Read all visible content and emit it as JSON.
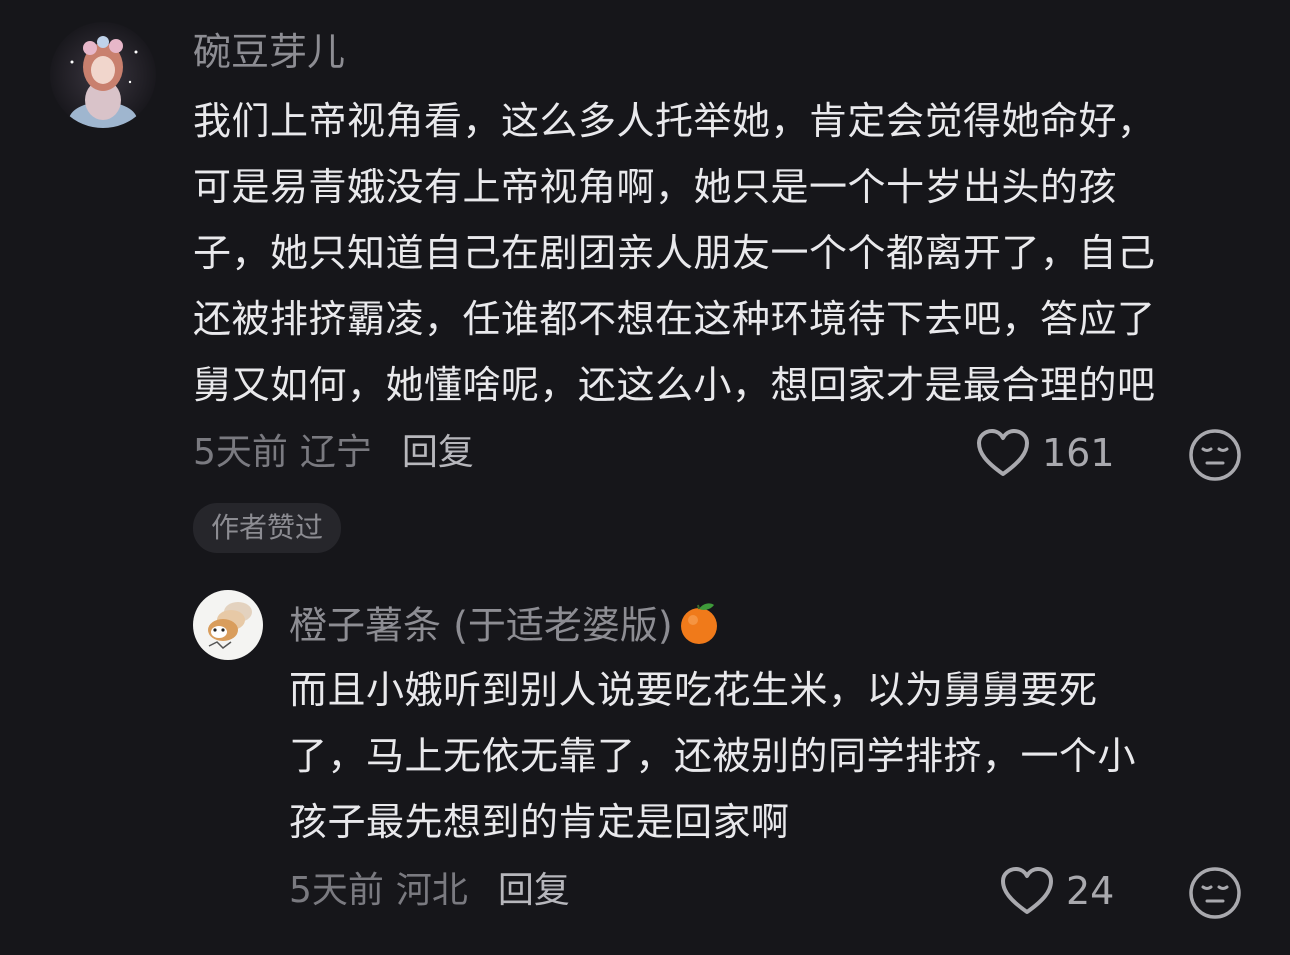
{
  "comments": [
    {
      "username": "碗豆芽儿",
      "lines": [
        "我们上帝视角看，这么多人托举她，肯定会觉得她命好，",
        "可是易青娥没有上帝视角啊，她只是一个十岁出头的孩",
        "子，她只知道自己在剧团亲人朋友一个个都离开了，自己",
        "还被排挤霸凌，任谁都不想在这种环境待下去吧，答应了",
        "舅又如何，她懂啥呢，还这么小，想回家才是最合理的吧"
      ],
      "time": "5天前",
      "location": "辽宁",
      "reply_label": "回复",
      "likes": "161",
      "author_liked_label": "作者赞过"
    },
    {
      "username": "橙子薯条 (于适老婆版)",
      "lines": [
        "而且小娥听到别人说要吃花生米，以为舅舅要死",
        "了，马上无依无靠了，还被别的同学排挤，一个小",
        "孩子最先想到的肯定是回家啊"
      ],
      "time": "5天前",
      "location": "河北",
      "reply_label": "回复",
      "likes": "24"
    }
  ],
  "icons": {
    "like": "heart-outline-icon",
    "dislike": "meh-face-icon",
    "username_emoji": "orange-emoji-icon"
  },
  "colors": {
    "background": "#16161a",
    "body_text": "#e9e9ec",
    "username": "#8d8d93",
    "meta": "#7a7a80"
  }
}
